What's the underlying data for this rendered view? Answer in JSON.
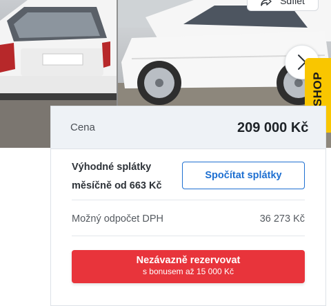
{
  "gallery": {
    "share_label": "Sdílet",
    "next_icon": "chevron-right-icon",
    "photos": [
      "car-rear-photo",
      "car-side-photo"
    ]
  },
  "eshop_tab": {
    "label": "E-SHOP",
    "color": "#f9c600"
  },
  "price": {
    "label": "Cena",
    "value": "209 000 Kč"
  },
  "installments": {
    "text": "Výhodné splátky měsíčně od 663 Kč",
    "button_label": "Spočítat splátky"
  },
  "vat": {
    "label": "Možný odpočet DPH",
    "value": "36 273 Kč"
  },
  "reserve": {
    "title": "Nezávazně rezervovat",
    "subtitle": "s bonusem až 15 000 Kč",
    "color": "#e8343b"
  },
  "colors": {
    "accent_blue": "#1d6fd1",
    "panel_bg": "#eef2f6"
  }
}
